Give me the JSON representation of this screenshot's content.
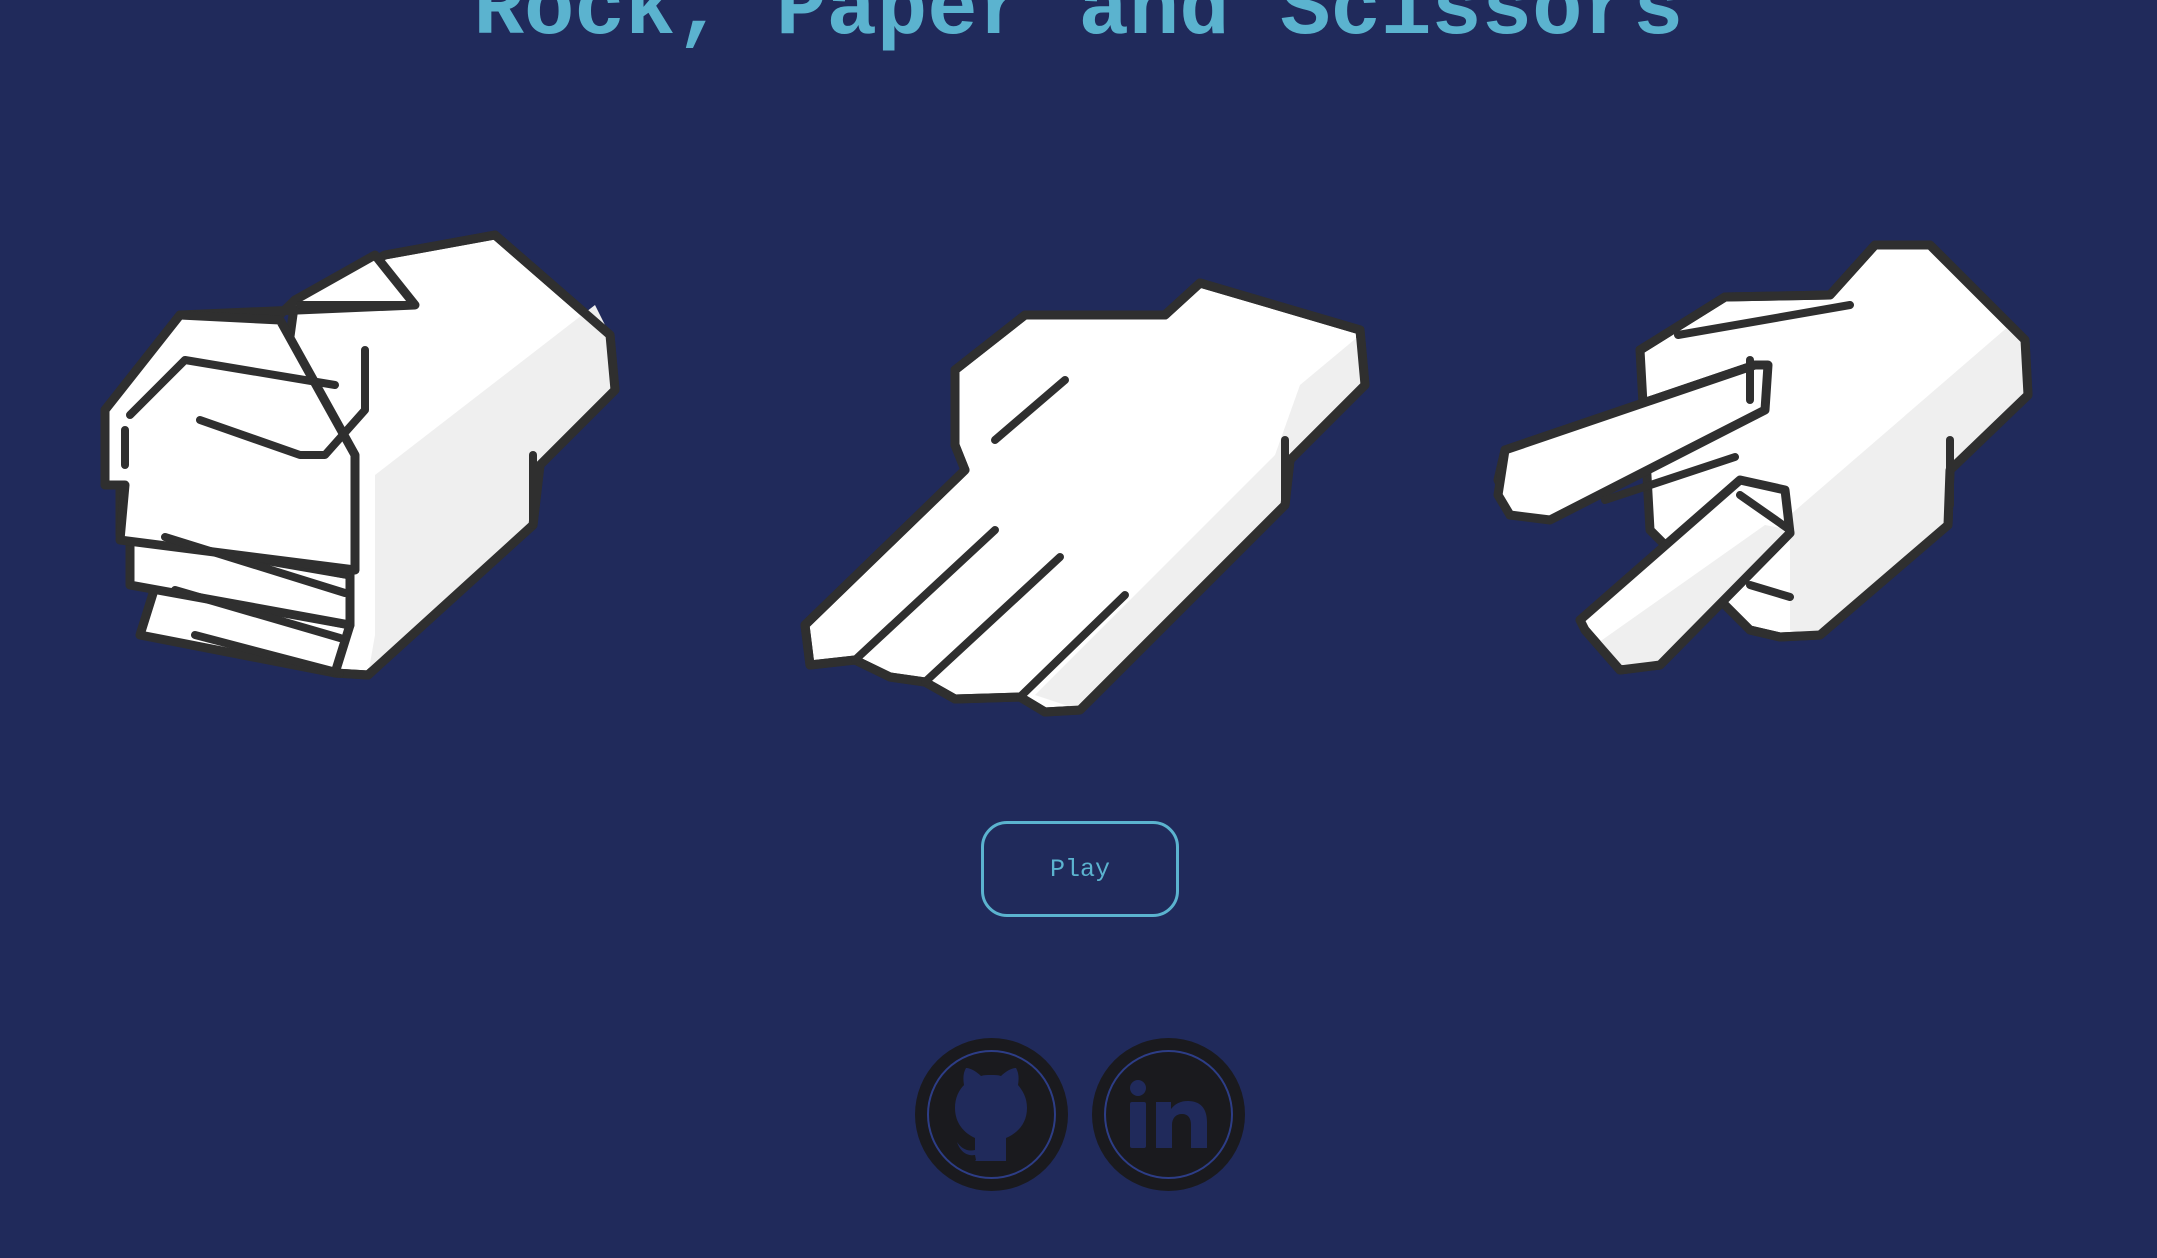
{
  "page": {
    "title": "Rock, Paper and Scissors"
  },
  "choices": [
    {
      "name": "rock",
      "icon": "rock-hand-icon"
    },
    {
      "name": "paper",
      "icon": "paper-hand-icon"
    },
    {
      "name": "scissors",
      "icon": "scissors-hand-icon"
    }
  ],
  "actions": {
    "play_label": "Play"
  },
  "social": {
    "github_icon": "github-icon",
    "linkedin_icon": "linkedin-icon"
  },
  "colors": {
    "background": "#202a5b",
    "accent": "#5bb3cf",
    "hand_fill": "#ffffff",
    "hand_shade": "#efefef",
    "outline": "#2f2f2f",
    "social_bg": "#1a1a1e"
  }
}
